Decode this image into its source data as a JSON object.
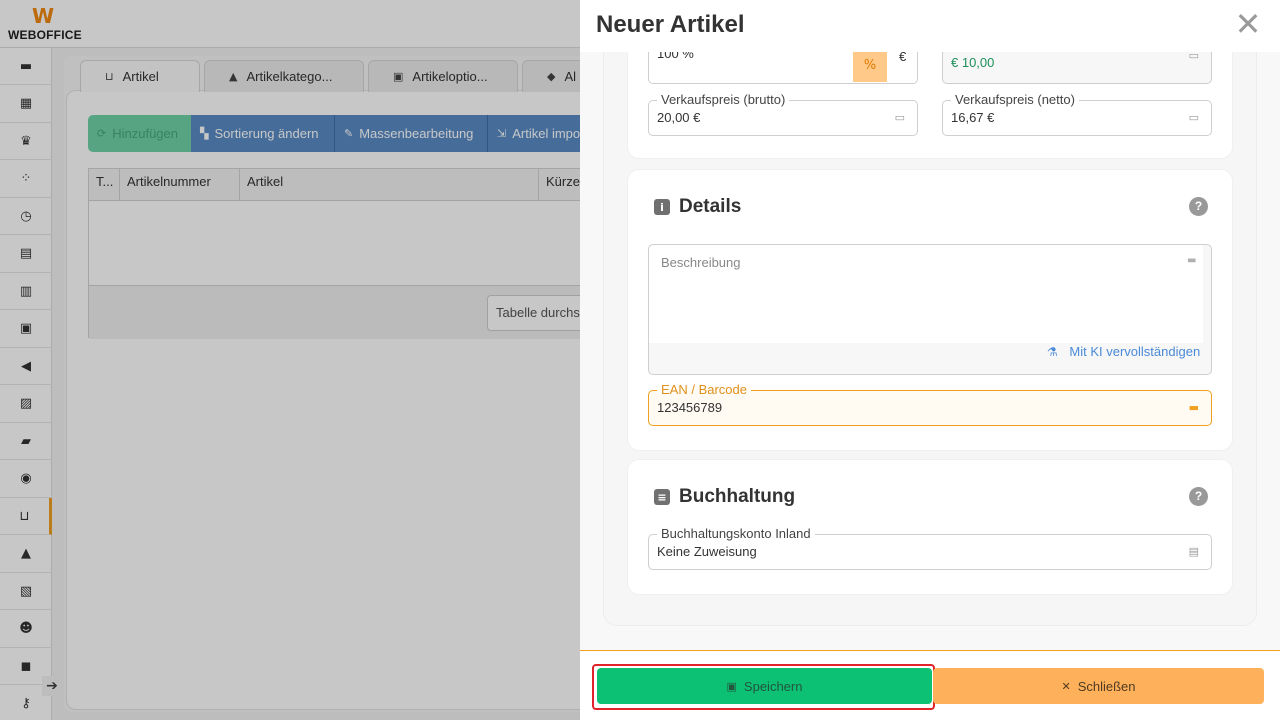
{
  "app": {
    "logo_text": "WEBOFFICE",
    "logo_mark": "W"
  },
  "sidebar": {
    "items": [
      {
        "icon": "inbox-icon",
        "glyph": "▬"
      },
      {
        "icon": "calendar-icon",
        "glyph": "▦"
      },
      {
        "icon": "crown-icon",
        "glyph": "♛"
      },
      {
        "icon": "network-icon",
        "glyph": "⁘"
      },
      {
        "icon": "clock-icon",
        "glyph": "◷"
      },
      {
        "icon": "document-icon",
        "glyph": "▤"
      },
      {
        "icon": "invoice-icon",
        "glyph": "▥"
      },
      {
        "icon": "boxes-icon",
        "glyph": "▣"
      },
      {
        "icon": "megaphone-icon",
        "glyph": "◀"
      },
      {
        "icon": "chart-icon",
        "glyph": "▨"
      },
      {
        "icon": "folder-icon",
        "glyph": "▰"
      },
      {
        "icon": "database-icon",
        "glyph": "◉"
      },
      {
        "icon": "cart-icon",
        "glyph": "⊔",
        "active": true
      },
      {
        "icon": "warehouse-icon",
        "glyph": "▲"
      },
      {
        "icon": "stats-icon",
        "glyph": "▧"
      },
      {
        "icon": "users-icon",
        "glyph": "☻"
      },
      {
        "icon": "truck-icon",
        "glyph": "◼"
      },
      {
        "icon": "key-icon",
        "glyph": "⚷"
      }
    ]
  },
  "tabs": [
    {
      "label": "Artikel",
      "icon": "cart-icon",
      "glyph": "⊔"
    },
    {
      "label": "Artikelkatego...",
      "icon": "shapes-icon",
      "glyph": "▲"
    },
    {
      "label": "Artikeloptio...",
      "icon": "options-icon",
      "glyph": "▣"
    },
    {
      "label": "Al",
      "icon": "tag-icon",
      "glyph": "◆"
    }
  ],
  "toolbar": {
    "add_label": "Hinzufügen",
    "sort_label": "Sortierung ändern",
    "bulk_label": "Massenbearbeitung",
    "import_label": "Artikel impo"
  },
  "grid": {
    "columns": [
      "T...",
      "Artikelnummer",
      "Artikel",
      "Kürze"
    ],
    "search_placeholder": "Tabelle durchsuchen"
  },
  "drawer": {
    "title": "Neuer Artikel",
    "close_glyph": "✕",
    "pricing": {
      "tax_value": "100 %",
      "currency": "€",
      "purchase_value": "€ 10,00",
      "gross_label": "Verkaufspreis (brutto)",
      "gross_value": "20,00 €",
      "net_label": "Verkaufspreis (netto)",
      "net_value": "16,67 €"
    },
    "details": {
      "title": "Details",
      "description_placeholder": "Beschreibung",
      "ai_link": "Mit KI vervollständigen",
      "ean_label": "EAN / Barcode",
      "ean_value": "123456789"
    },
    "accounting": {
      "title": "Buchhaltung",
      "account_label": "Buchhaltungskonto Inland",
      "account_value": "Keine Zuweisung"
    },
    "help_glyph": "?",
    "footer": {
      "save_label": "Speichern",
      "close_label": "Schließen"
    }
  },
  "colors": {
    "accent_orange": "#f0a020",
    "save_green": "#0cc174",
    "close_orange": "#ffb05a",
    "highlight_red": "#e0242a",
    "link_blue": "#4a8ad6",
    "money_green": "#1e8f5a"
  }
}
